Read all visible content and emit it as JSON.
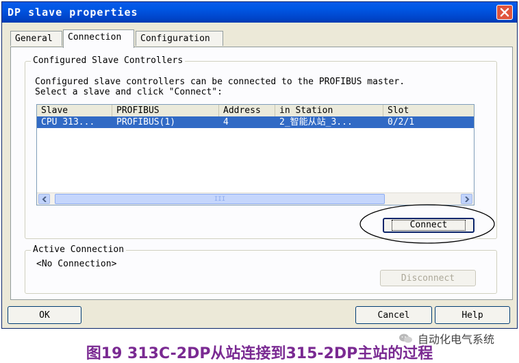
{
  "window": {
    "title": "DP slave properties"
  },
  "tabs": [
    {
      "label": "General"
    },
    {
      "label": "Connection"
    },
    {
      "label": "Configuration"
    }
  ],
  "configured_group": {
    "legend": "Configured Slave Controllers",
    "instruction_line1": "Configured slave controllers can be connected to the PROFIBUS master.",
    "instruction_line2": "Select a slave and click \"Connect\":"
  },
  "table": {
    "columns": [
      "Slave",
      "PROFIBUS",
      "Address",
      "in Station",
      "Slot"
    ],
    "rows": [
      [
        "CPU 313...",
        "PROFIBUS(1)",
        "4",
        "2_智能从站_3...",
        "0/2/1"
      ]
    ],
    "scroll_grip_label": "III"
  },
  "buttons": {
    "connect": "Connect",
    "disconnect": "Disconnect",
    "ok": "OK",
    "cancel": "Cancel",
    "help": "Help"
  },
  "active_group": {
    "legend": "Active Connection",
    "status": "<No Connection>"
  },
  "caption": {
    "text": "图19  313C-2DP从站连接到315-2DP主站的过程"
  },
  "watermark": {
    "text": "自动化电气系统"
  },
  "colors": {
    "title_bar": "#0054e3",
    "selection": "#316ac5",
    "caption": "#7a2a92",
    "annotation": "#000000"
  },
  "icons": [
    "close-icon",
    "scroll-left-icon",
    "scroll-right-icon",
    "wechat-icon"
  ]
}
